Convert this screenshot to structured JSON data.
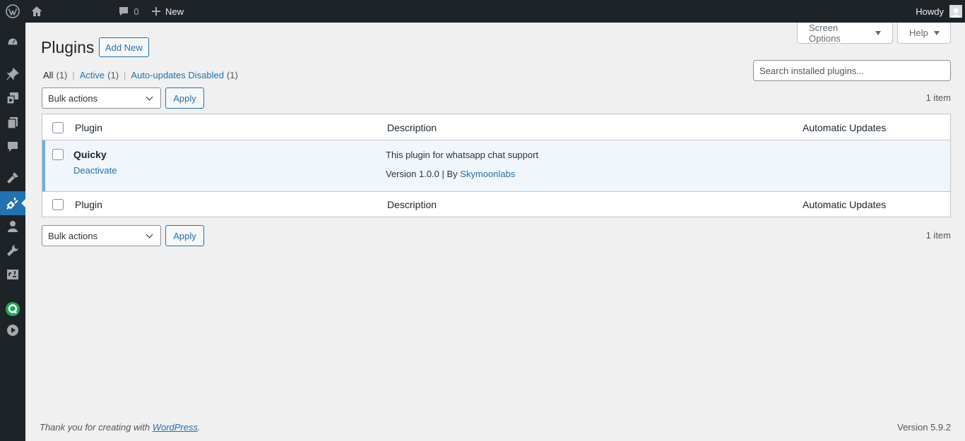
{
  "adminbar": {
    "comments_count": "0",
    "new_label": "New",
    "howdy": "Howdy"
  },
  "header": {
    "screen_options": "Screen Options",
    "help": "Help",
    "title": "Plugins",
    "add_new": "Add New"
  },
  "filters": [
    {
      "label": "All",
      "count": "(1)"
    },
    {
      "label": "Active",
      "count": "(1)"
    },
    {
      "label": "Auto-updates Disabled",
      "count": "(1)"
    }
  ],
  "search": {
    "placeholder": "Search installed plugins..."
  },
  "bulk": {
    "label": "Bulk actions",
    "apply": "Apply",
    "items": "1 item"
  },
  "table": {
    "columns": [
      "Plugin",
      "Description",
      "Automatic Updates"
    ],
    "rows": [
      {
        "name": "Quicky",
        "action": "Deactivate",
        "description": "This plugin for whatsapp chat support",
        "version_prefix": "Version 1.0.0 | By",
        "author": "Skymoonlabs"
      }
    ]
  },
  "footer": {
    "thanks_prefix": "Thank you for creating with",
    "wordpress_link": "WordPress",
    "thanks_suffix": ".",
    "version": "Version 5.9.2"
  },
  "icons": {
    "sidebar": [
      "dashboard-icon",
      "posts-pin-icon",
      "media-icon",
      "pages-icon",
      "comments-icon",
      "appearance-icon",
      "plugins-icon",
      "users-icon",
      "tools-icon",
      "settings-icon",
      "quicky-q-icon",
      "play-icon"
    ]
  },
  "colors": {
    "accent": "#2271b1",
    "dark": "#1d2327",
    "active_row_border": "#72aee6"
  }
}
